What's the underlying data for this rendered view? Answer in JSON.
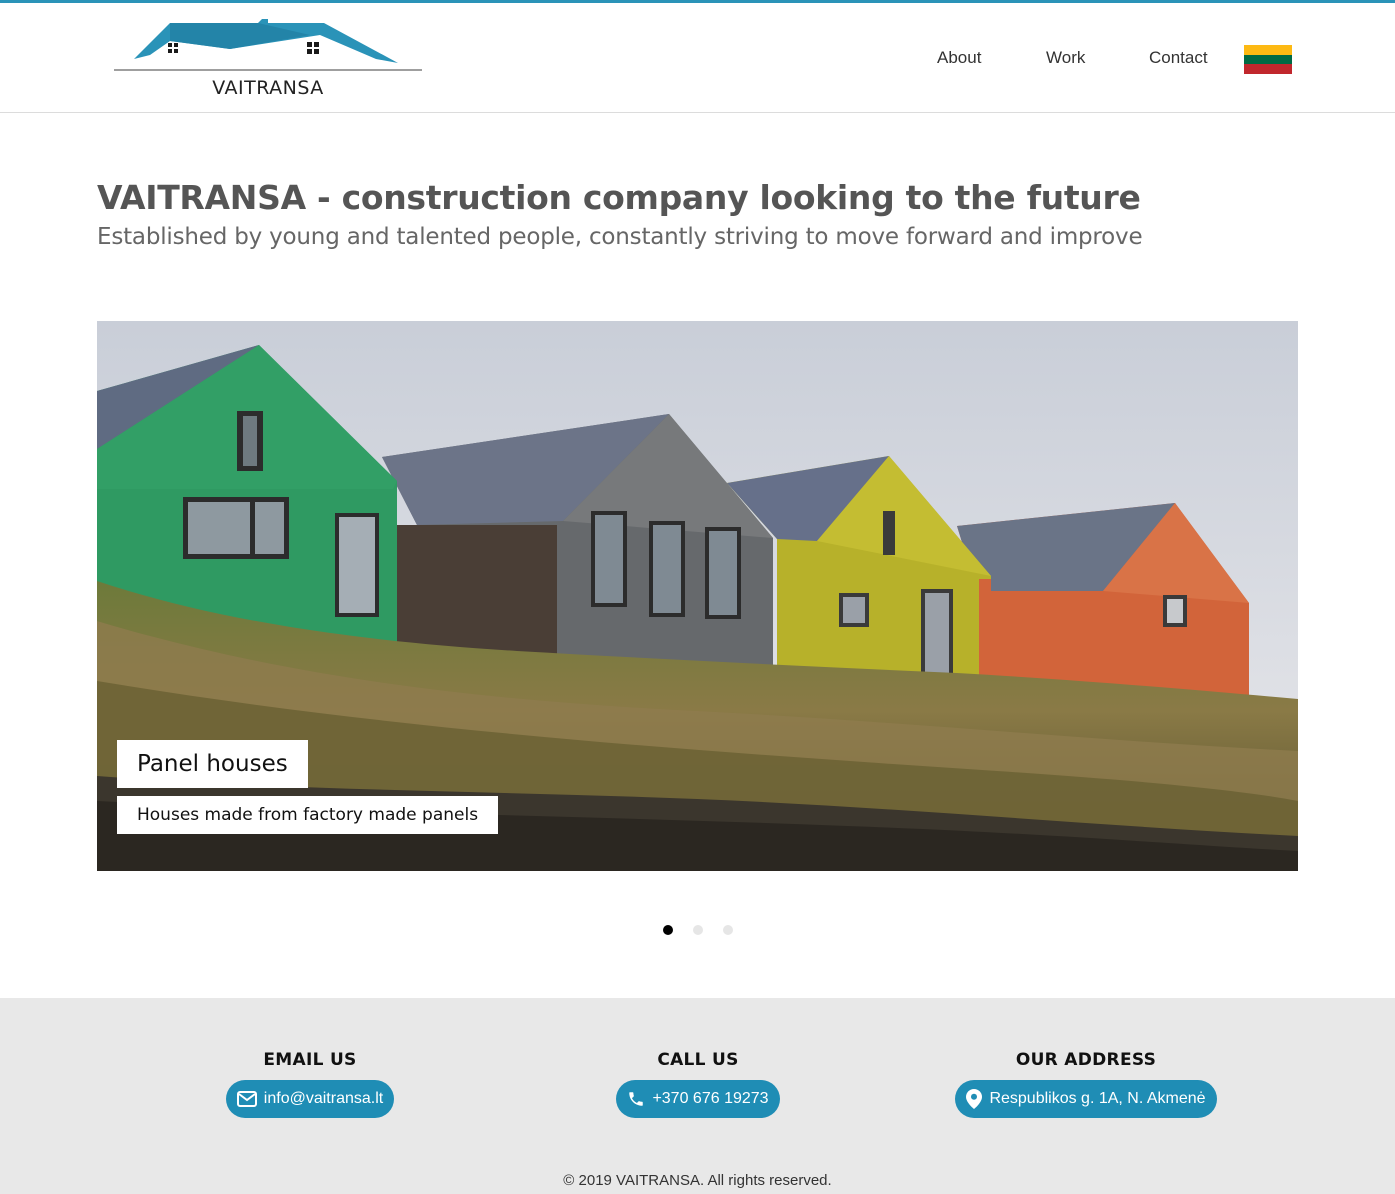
{
  "brand": {
    "name": "VAITRANSA",
    "accent": "#2a93b8",
    "pill_color": "#1f8db5"
  },
  "nav": {
    "about": "About",
    "work": "Work",
    "contact": "Contact",
    "language_flag": "lithuania-flag-icon"
  },
  "hero": {
    "title": "VAITRANSA - construction company looking to the future",
    "subtitle": "Established by young and talented people, constantly striving to move forward and improve"
  },
  "slider": {
    "caption_title": "Panel houses",
    "caption_text": "Houses made from factory made panels",
    "slide_count": 3,
    "active_index": 0
  },
  "footer": {
    "email": {
      "heading": "EMAIL US",
      "value": "info@vaitransa.lt",
      "icon": "mail-icon"
    },
    "phone": {
      "heading": "CALL US",
      "value": "+370 676 19273",
      "icon": "phone-icon"
    },
    "address": {
      "heading": "OUR ADDRESS",
      "value": "Respublikos g. 1A, N. Akmenė",
      "icon": "map-pin-icon"
    },
    "copyright": "© 2019 VAITRANSA. All rights reserved."
  }
}
